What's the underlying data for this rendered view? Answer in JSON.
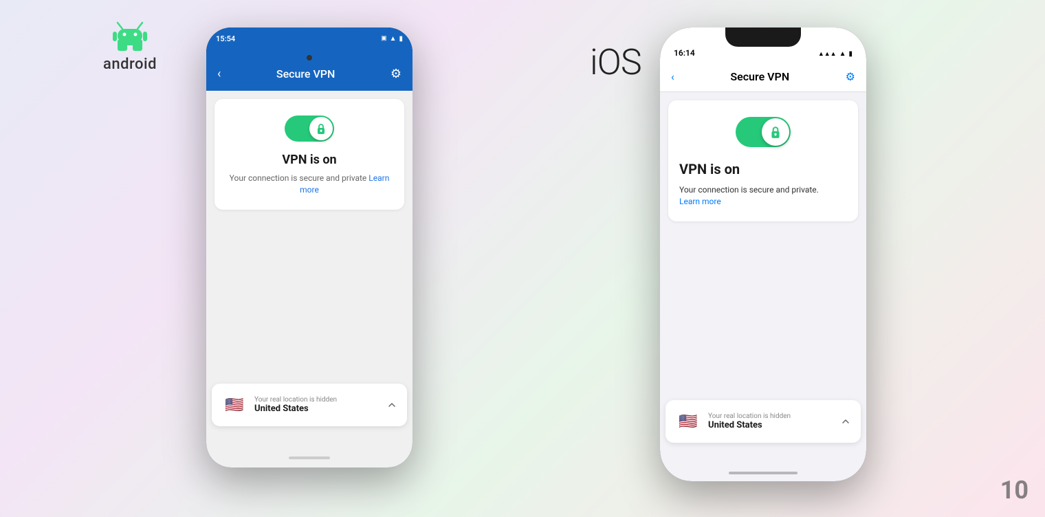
{
  "android": {
    "platform_label": "android",
    "android_icon_alt": "android logo",
    "status_time": "15:54",
    "top_bar_title": "Secure VPN",
    "vpn_status_title": "VPN is on",
    "vpn_subtitle": "Your connection is secure and private",
    "learn_more": "Learn more",
    "location_hidden_text": "Your real location is hidden",
    "location_country": "United States",
    "flag_emoji": "🇺🇸"
  },
  "ios": {
    "platform_label": "iOS",
    "status_time": "16:14",
    "top_bar_title": "Secure VPN",
    "vpn_status_title": "VPN is on",
    "vpn_subtitle": "Your connection is secure and private.",
    "learn_more": "Learn more",
    "location_hidden_text": "Your real location is hidden",
    "location_country": "United States",
    "flag_emoji": "🇺🇸"
  },
  "watermark": "10",
  "colors": {
    "android_header": "#1565c0",
    "toggle_green": "#26c97a",
    "learn_more_blue": "#1a73e8",
    "ios_blue": "#007aff"
  }
}
